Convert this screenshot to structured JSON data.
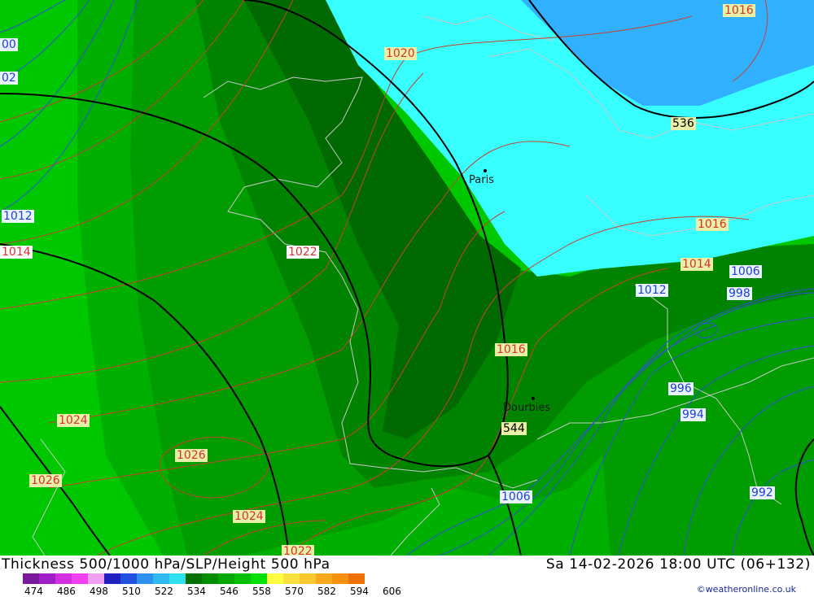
{
  "map": {
    "cities": [
      {
        "name": "Paris"
      },
      {
        "name": "Dourbies"
      }
    ],
    "slp_labels": [
      {
        "text": "1016",
        "style": "red"
      },
      {
        "text": "1020",
        "style": "red"
      },
      {
        "text": "1016",
        "style": "red"
      },
      {
        "text": "1014",
        "style": "red"
      },
      {
        "text": "1012",
        "style": "blue"
      },
      {
        "text": "1014",
        "style": "white"
      },
      {
        "text": "1022",
        "style": "white"
      },
      {
        "text": "1016",
        "style": "red"
      },
      {
        "text": "1024",
        "style": "red"
      },
      {
        "text": "1026",
        "style": "red"
      },
      {
        "text": "1026",
        "style": "red"
      },
      {
        "text": "1024",
        "style": "red"
      },
      {
        "text": "1022",
        "style": "red"
      },
      {
        "text": "1006",
        "style": "blue"
      },
      {
        "text": "1012",
        "style": "blue"
      },
      {
        "text": "998",
        "style": "blue"
      },
      {
        "text": "1006",
        "style": "blue"
      },
      {
        "text": "996",
        "style": "blue"
      },
      {
        "text": "994",
        "style": "blue"
      },
      {
        "text": "992",
        "style": "blue"
      },
      {
        "text": "00",
        "style": "blue"
      },
      {
        "text": "02",
        "style": "blue"
      }
    ],
    "height_labels": [
      {
        "text": "536"
      },
      {
        "text": "544"
      }
    ]
  },
  "footer": {
    "title": "Thickness 500/1000 hPa/SLP/Height 500 hPa",
    "timestamp": "Sa 14-02-2026 18:00 UTC (06+132)",
    "credit": "©weatheronline.co.uk"
  },
  "legend": {
    "ticks": [
      "474",
      "486",
      "498",
      "510",
      "522",
      "534",
      "546",
      "558",
      "570",
      "582",
      "594",
      "606"
    ],
    "colors": [
      "#7a1a9a",
      "#a020c8",
      "#d030e0",
      "#f040f0",
      "#f0a0f0",
      "#2020c0",
      "#2050e0",
      "#3090f0",
      "#30b8f0",
      "#30e0f0",
      "#007000",
      "#008c00",
      "#00a800",
      "#00c000",
      "#00e000",
      "#ffff40",
      "#f8e040",
      "#f8c830",
      "#f8a820",
      "#f89010",
      "#f07000"
    ]
  }
}
